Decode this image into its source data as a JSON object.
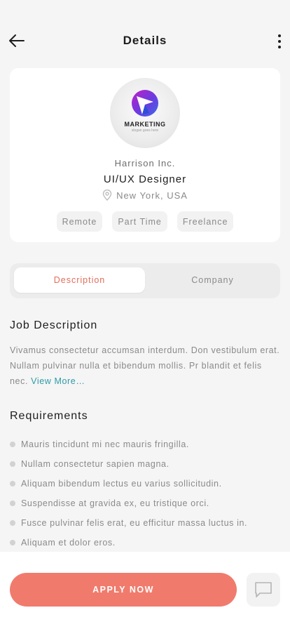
{
  "header": {
    "title": "Details",
    "back_icon": "arrow-left-icon",
    "more_icon": "more-vertical-icon"
  },
  "company": {
    "logo_word": "MARKETING",
    "logo_slogan": "slogan goes here",
    "name": "Harrison Inc.",
    "job_title": "UI/UX Designer",
    "location": "New York, USA",
    "tags": [
      "Remote",
      "Part Time",
      "Freelance"
    ]
  },
  "tabs": {
    "description": "Description",
    "company": "Company",
    "active": "description"
  },
  "job_description": {
    "title": "Job Description",
    "text": "Vivamus consectetur accumsan interdum. Don vestibulum erat. Nullam pulvinar nulla et bibendum mollis. Pr blandit et felis nec.",
    "view_more": "View More…"
  },
  "requirements": {
    "title": "Requirements",
    "items": [
      "Mauris tincidunt mi nec mauris fringilla.",
      "Nullam consectetur sapien magna.",
      "Aliquam bibendum lectus eu varius sollicitudin.",
      "Suspendisse at gravida ex, eu tristique orci.",
      "Fusce pulvinar felis erat, eu efficitur massa luctus in.",
      "Aliquam et dolor eros."
    ]
  },
  "actions": {
    "apply_label": "APPLY NOW",
    "chat_icon": "chat-icon"
  },
  "colors": {
    "accent": "#f07b6d",
    "active_tab_text": "#e26d5a",
    "link": "#2e9aa8"
  }
}
